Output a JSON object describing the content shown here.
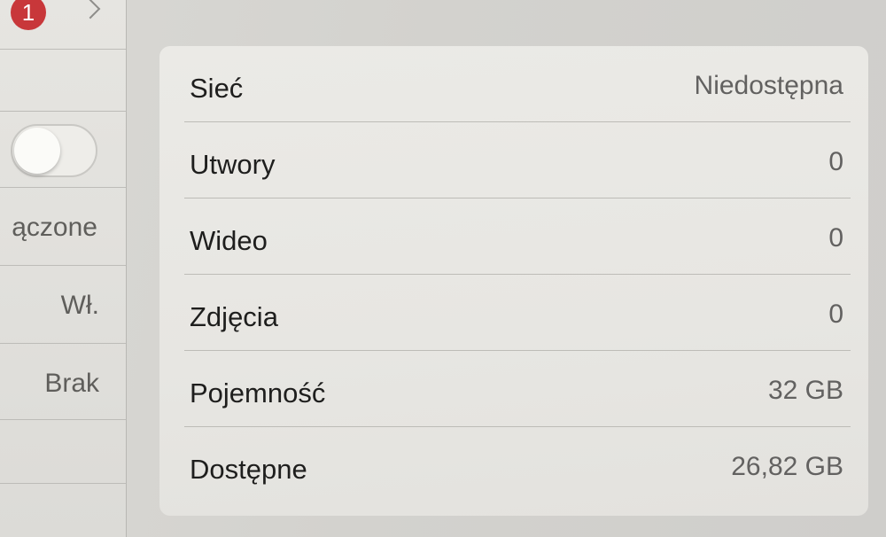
{
  "left_pane": {
    "badge_count": "1",
    "labels": [
      "ączone",
      "Wł.",
      "Brak"
    ]
  },
  "info_table": {
    "rows": [
      {
        "label": "Sieć",
        "value": "Niedostępna"
      },
      {
        "label": "Utwory",
        "value": "0"
      },
      {
        "label": "Wideo",
        "value": "0"
      },
      {
        "label": "Zdjęcia",
        "value": "0"
      },
      {
        "label": "Pojemność",
        "value": "32 GB"
      },
      {
        "label": "Dostępne",
        "value": "26,82 GB"
      }
    ]
  },
  "colors": {
    "badge": "#c8373a",
    "label_text": "#1e1e1d",
    "value_text": "#626160"
  },
  "icons": [
    "chevron-right-icon"
  ]
}
